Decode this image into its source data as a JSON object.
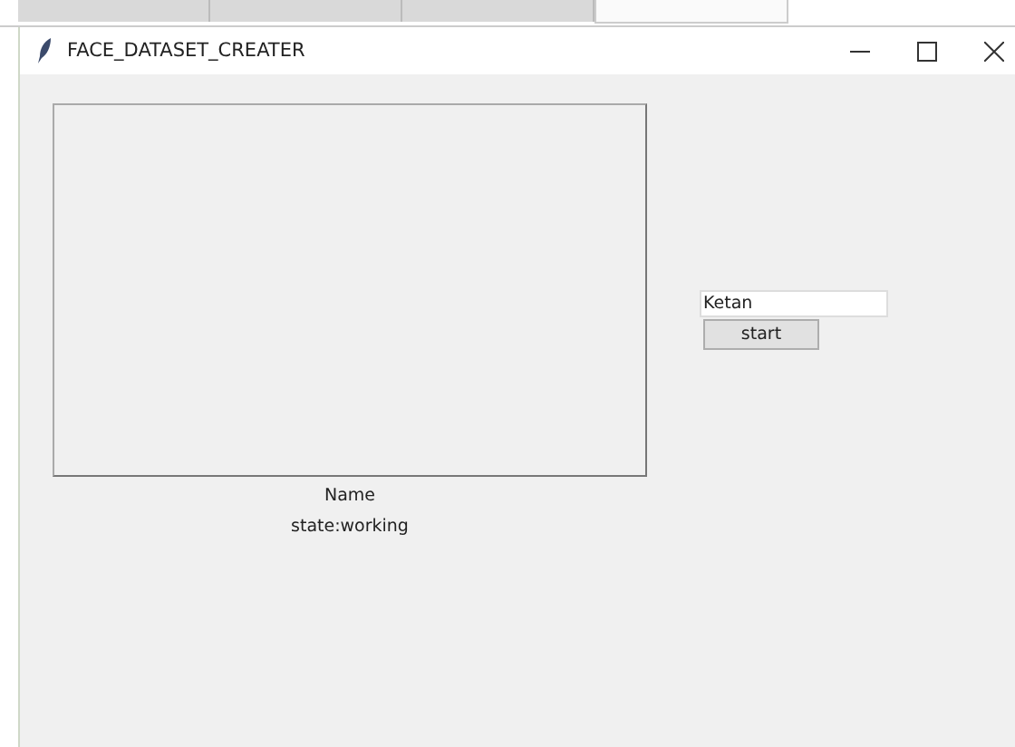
{
  "editor_tabs": [
    {
      "selected": false
    },
    {
      "selected": false
    },
    {
      "selected": false
    },
    {
      "selected": true
    }
  ],
  "window": {
    "title": "FACE_DATASET_CREATER"
  },
  "name_field": {
    "value": "Ketan"
  },
  "start_button": {
    "label": "start"
  },
  "name_label": "Name",
  "state_label": "state:working"
}
